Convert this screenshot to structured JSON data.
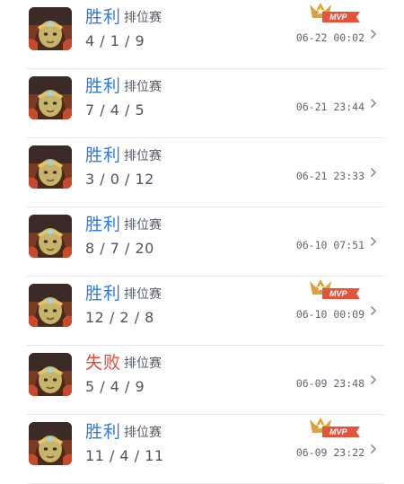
{
  "colors": {
    "win": "#2f79e6",
    "loss": "#e14a3a",
    "mvp_gold": "#d9a23a",
    "mvp_red": "#e0533c"
  },
  "icons": {
    "avatar": "hero-portrait-avatar",
    "mvp": "mvp-crown-badge-icon",
    "chevron": "chevron-right-icon"
  },
  "matches": [
    {
      "result": "胜利",
      "outcome": "win",
      "mode": "排位赛",
      "kda": "4 / 1 / 9",
      "time": "06-22 00:02",
      "mvp": true,
      "mvp_label": "MVP"
    },
    {
      "result": "胜利",
      "outcome": "win",
      "mode": "排位赛",
      "kda": "7 / 4 / 5",
      "time": "06-21 23:44",
      "mvp": false
    },
    {
      "result": "胜利",
      "outcome": "win",
      "mode": "排位赛",
      "kda": "3 / 0 / 12",
      "time": "06-21 23:33",
      "mvp": false
    },
    {
      "result": "胜利",
      "outcome": "win",
      "mode": "排位赛",
      "kda": "8 / 7 / 20",
      "time": "06-10 07:51",
      "mvp": false
    },
    {
      "result": "胜利",
      "outcome": "win",
      "mode": "排位赛",
      "kda": "12 / 2 / 8",
      "time": "06-10 00:09",
      "mvp": true,
      "mvp_label": "MVP"
    },
    {
      "result": "失败",
      "outcome": "loss",
      "mode": "排位赛",
      "kda": "5 / 4 / 9",
      "time": "06-09 23:48",
      "mvp": false
    },
    {
      "result": "胜利",
      "outcome": "win",
      "mode": "排位赛",
      "kda": "11 / 4 / 11",
      "time": "06-09 23:22",
      "mvp": true,
      "mvp_label": "MVP"
    }
  ]
}
